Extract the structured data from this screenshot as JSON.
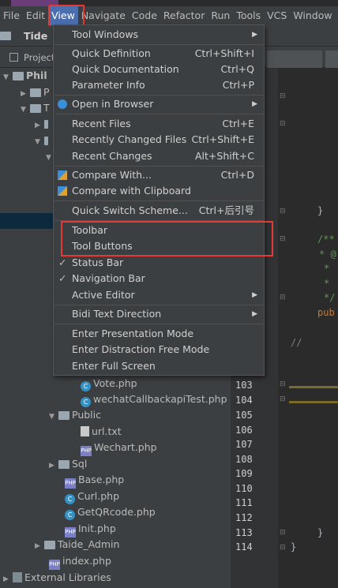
{
  "menubar": {
    "items": [
      "File",
      "Edit",
      "View",
      "Navigate",
      "Code",
      "Refactor",
      "Run",
      "Tools",
      "VCS",
      "Window"
    ]
  },
  "navbar": {
    "title": "Tide"
  },
  "tabbar": {
    "project_label": "Project"
  },
  "view_menu": {
    "items": [
      {
        "label": "Tool Windows",
        "shortcut": "",
        "submenu": true
      },
      {
        "label": "Quick Definition",
        "shortcut": "Ctrl+Shift+I"
      },
      {
        "label": "Quick Documentation",
        "shortcut": "Ctrl+Q"
      },
      {
        "label": "Parameter Info",
        "shortcut": "Ctrl+P"
      },
      {
        "label": "Open in Browser",
        "shortcut": "",
        "submenu": true
      },
      {
        "label": "Recent Files",
        "shortcut": "Ctrl+E"
      },
      {
        "label": "Recently Changed Files",
        "shortcut": "Ctrl+Shift+E"
      },
      {
        "label": "Recent Changes",
        "shortcut": "Alt+Shift+C"
      },
      {
        "label": "Compare With...",
        "shortcut": "Ctrl+D"
      },
      {
        "label": "Compare with Clipboard",
        "shortcut": ""
      },
      {
        "label": "Quick Switch Scheme...",
        "shortcut": "Ctrl+后引号"
      },
      {
        "label": "Toolbar",
        "shortcut": ""
      },
      {
        "label": "Tool Buttons",
        "shortcut": ""
      },
      {
        "label": "Status Bar",
        "shortcut": "",
        "checked": true
      },
      {
        "label": "Navigation Bar",
        "shortcut": "",
        "checked": true
      },
      {
        "label": "Active Editor",
        "shortcut": "",
        "submenu": true
      },
      {
        "label": "Bidi Text Direction",
        "shortcut": "",
        "submenu": true
      },
      {
        "label": "Enter Presentation Mode",
        "shortcut": ""
      },
      {
        "label": "Enter Distraction Free Mode",
        "shortcut": ""
      },
      {
        "label": "Enter Full Screen",
        "shortcut": ""
      }
    ],
    "submenu_glyph": "▶",
    "check_glyph": "✓"
  },
  "tree": {
    "top_label": "Phil",
    "top_label_2": "P",
    "top_label_3": "T",
    "items": [
      {
        "label": "Vote.php",
        "kind": "class"
      },
      {
        "label": "wechatCallbackapiTest.php",
        "kind": "class"
      },
      {
        "label": "Public",
        "kind": "folder"
      },
      {
        "label": "url.txt",
        "kind": "text"
      },
      {
        "label": "Wechart.php",
        "kind": "php"
      },
      {
        "label": "Sql",
        "kind": "folder"
      },
      {
        "label": "Base.php",
        "kind": "php"
      },
      {
        "label": "Curl.php",
        "kind": "class"
      },
      {
        "label": "GetQRcode.php",
        "kind": "class"
      },
      {
        "label": "Init.php",
        "kind": "php"
      },
      {
        "label": "Taide_Admin",
        "kind": "folder"
      },
      {
        "label": "index.php",
        "kind": "php"
      },
      {
        "label": "External Libraries",
        "kind": "libs"
      }
    ]
  },
  "editor": {
    "line_numbers": [
      "103",
      "104",
      "105",
      "106",
      "107",
      "108",
      "109",
      "110",
      "111",
      "112",
      "113",
      "114"
    ],
    "code": {
      "brace1": "}",
      "doc1": "/**",
      "doc2": "* @",
      "doc3": "*",
      "doc4": "*",
      "doc5": "*/",
      "pub": "pub",
      "comment": "//",
      "brace2": "}",
      "brace3": "}"
    }
  },
  "colors": {
    "accent": "#4b6eaf",
    "highlight": "#e53935",
    "keyword": "#cc7832",
    "doc": "#629755"
  }
}
